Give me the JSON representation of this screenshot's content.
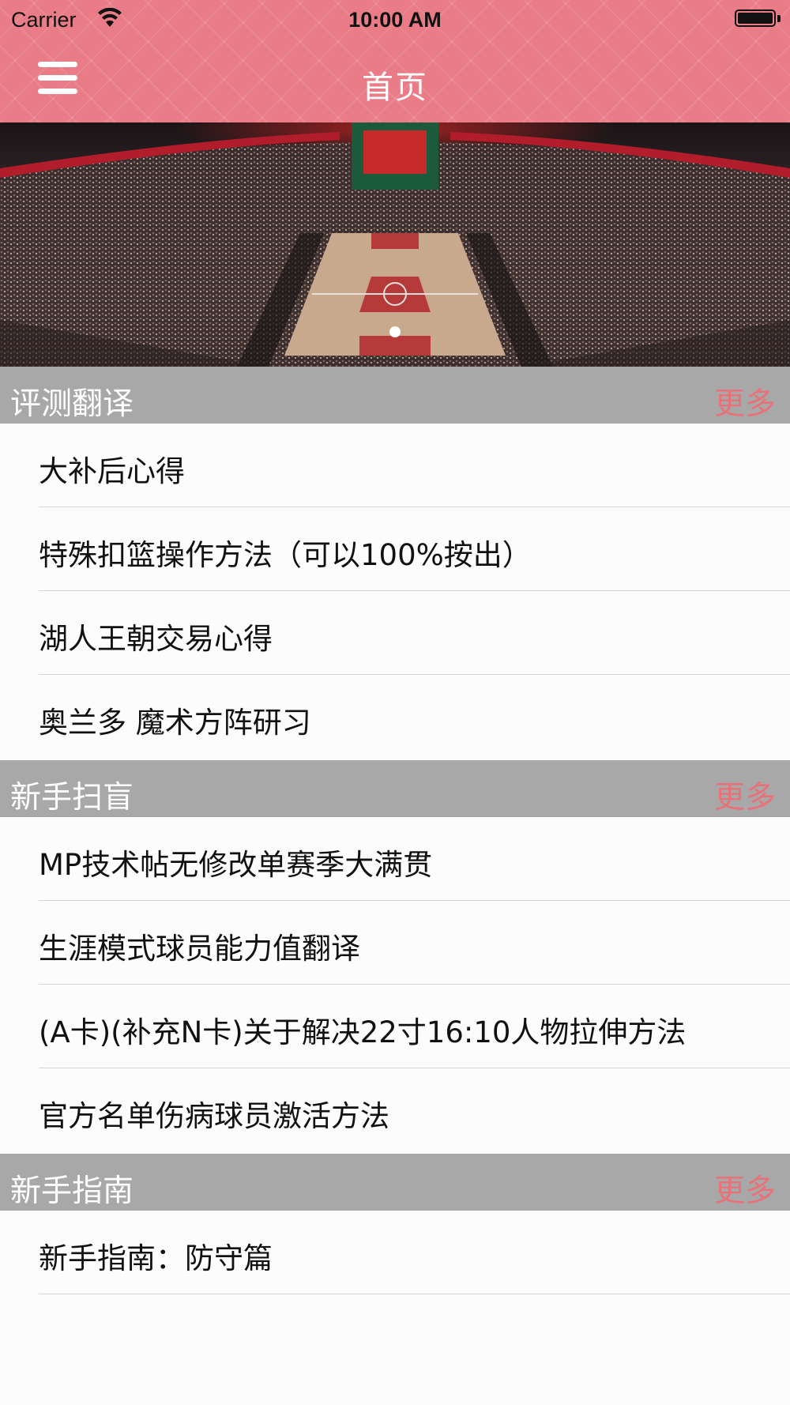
{
  "status_bar": {
    "carrier": "Carrier",
    "time": "10:00 AM"
  },
  "nav": {
    "title": "首页",
    "menu_icon": "hamburger-menu-icon",
    "color": "#e97c86"
  },
  "banner": {
    "pages": 1,
    "current_page": 1
  },
  "sections": [
    {
      "title": "评测翻译",
      "more": "更多",
      "items": [
        "大补后心得",
        "特殊扣篮操作方法（可以100%按出）",
        "湖人王朝交易心得",
        "奥兰多 魔术方阵研习"
      ]
    },
    {
      "title": "新手扫盲",
      "more": "更多",
      "items": [
        "MP技术帖无修改单赛季大满贯",
        "生涯模式球员能力值翻译",
        "(A卡)(补充N卡)关于解决22寸16:10人物拉伸方法",
        "官方名单伤病球员激活方法"
      ]
    },
    {
      "title": "新手指南",
      "more": "更多",
      "items": [
        "新手指南：防守篇"
      ]
    }
  ]
}
